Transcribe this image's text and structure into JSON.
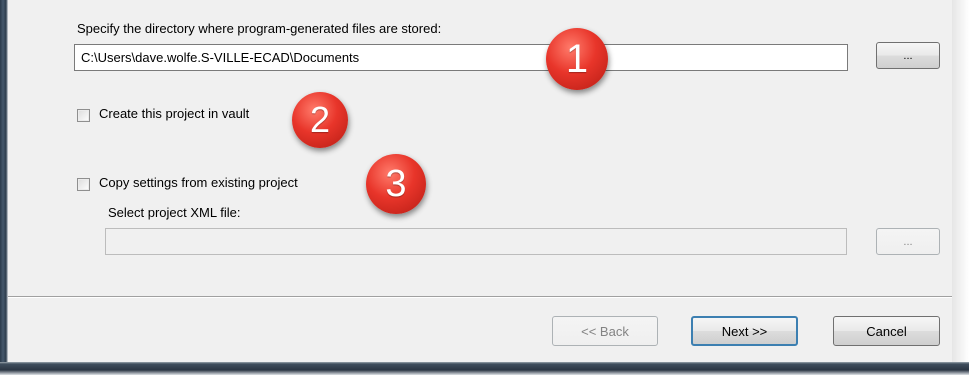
{
  "directory": {
    "prompt": "Specify the directory where program-generated files are stored:",
    "path_value": "C:\\Users\\dave.wolfe.S-VILLE-ECAD\\Documents",
    "browse_label": "..."
  },
  "vault": {
    "label": "Create this project in vault",
    "checked": false
  },
  "copy_settings": {
    "label": "Copy settings from existing project",
    "checked": false,
    "xml_prompt": "Select project XML file:",
    "xml_value": "",
    "browse_label": "..."
  },
  "badges": [
    "1",
    "2",
    "3"
  ],
  "footer": {
    "back_label": "<< Back",
    "next_label": "Next >>",
    "cancel_label": "Cancel"
  },
  "colors": {
    "dialog_bg": "#f0f0f0",
    "badge_red": "#e8352a",
    "default_button_border": "#3c7fb1"
  }
}
